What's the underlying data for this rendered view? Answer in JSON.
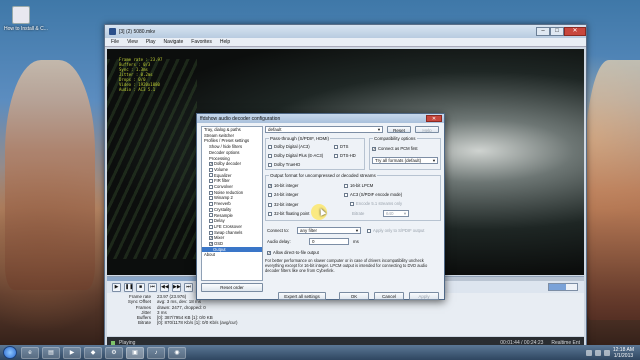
{
  "desktop": {
    "icon_label": "How to Install & C..."
  },
  "player": {
    "title": "[3] (2) 5080.mkv",
    "menu": [
      "File",
      "View",
      "Play",
      "Navigate",
      "Favorites",
      "Help"
    ],
    "osd_lines": [
      "Frame rate : 23.97",
      "Buffers : 0/3",
      "Sync : 1.3ms",
      "Jitter : 0.2ms",
      "Drops : 0/0",
      "Video : 1920x1080",
      "Audio : AC3 5.1"
    ],
    "seek_position_fraction": 0.27,
    "volume_fraction": 0.6,
    "stats": [
      {
        "k": "Frame rate",
        "v": "23.97 (23.976)"
      },
      {
        "k": "Sync Offset",
        "v": "avg: 3 ms, dev: 18 ms"
      },
      {
        "k": "Frames",
        "v": "drawn: 2477, dropped: 0"
      },
      {
        "k": "Jitter",
        "v": "3 ms"
      },
      {
        "k": "Buffers",
        "v": "[0]: 387/7954 KB [1]: 0/0 KB"
      },
      {
        "k": "Bitrate",
        "v": "[0]: 870/1178 Kb/s [1]: 0/0 Kb/s (avg/cur)"
      }
    ],
    "status": "Playing",
    "time": "00:01:44 / 00:24:23",
    "status_right": "Realtime Ent"
  },
  "dialog": {
    "title": "ffdshow audio decoder configuration",
    "preset_value": "default",
    "reset_label": "Reset",
    "help_label": "Help",
    "tree": [
      {
        "label": "Tray, dialog & paths",
        "level": 0,
        "check": null
      },
      {
        "label": "Stream switcher",
        "level": 0,
        "check": null
      },
      {
        "label": "Profiles / Preset settings",
        "level": 0,
        "check": null
      },
      {
        "label": "Show / hide filters",
        "level": 1,
        "check": null
      },
      {
        "label": "Decoder options",
        "level": 1,
        "check": null
      },
      {
        "label": "Processing",
        "level": 1,
        "check": null
      },
      {
        "label": "Dolby decoder",
        "level": 1,
        "check": true
      },
      {
        "label": "Volume",
        "level": 1,
        "check": false
      },
      {
        "label": "Equalizer",
        "level": 1,
        "check": false
      },
      {
        "label": "FIR filter",
        "level": 1,
        "check": false
      },
      {
        "label": "Convolver",
        "level": 1,
        "check": false
      },
      {
        "label": "Noise reduction",
        "level": 1,
        "check": false
      },
      {
        "label": "Winamp 2",
        "level": 1,
        "check": false
      },
      {
        "label": "Freeverb",
        "level": 1,
        "check": false
      },
      {
        "label": "Crystality",
        "level": 1,
        "check": false
      },
      {
        "label": "Resample",
        "level": 1,
        "check": false
      },
      {
        "label": "Delay",
        "level": 1,
        "check": false
      },
      {
        "label": "LFE Crossover",
        "level": 1,
        "check": false
      },
      {
        "label": "Swap channels",
        "level": 1,
        "check": false
      },
      {
        "label": "Mixer",
        "level": 1,
        "check": true
      },
      {
        "label": "OSD",
        "level": 1,
        "check": true
      },
      {
        "label": "Output",
        "level": 2,
        "check": null,
        "selected": true
      },
      {
        "label": "About",
        "level": 0,
        "check": null
      }
    ],
    "reset_order_label": "Reset order",
    "passthrough": {
      "title": "Pass-through (S/PDIF, HDMI)",
      "options": [
        {
          "label": "Dolby Digital (AC3)",
          "checked": false
        },
        {
          "label": "DTS",
          "checked": false
        },
        {
          "label": "Dolby Digital Plus (E-AC3)",
          "checked": false
        },
        {
          "label": "DTS-HD",
          "checked": false
        },
        {
          "label": "Dolby TrueHD",
          "checked": false
        }
      ]
    },
    "compat": {
      "title": "Compatibility options",
      "connect_pcm": "Connect as PCM first",
      "formats": "Try all formats (default)"
    },
    "output_format": {
      "title": "Output format for uncompressed or decoded streams",
      "left": [
        {
          "label": "16-bit integer",
          "checked": true
        },
        {
          "label": "24-bit integer",
          "checked": false
        },
        {
          "label": "32-bit integer",
          "checked": false
        },
        {
          "label": "32-bit floating point",
          "checked": false
        }
      ],
      "right": [
        {
          "label": "16-bit LPCM",
          "checked": false,
          "disabled": false
        },
        {
          "label": "AC3 (S/PDIF encode mode)",
          "checked": false,
          "disabled": false
        },
        {
          "label": "Encode 5.1 streams only",
          "checked": false,
          "disabled": true
        }
      ],
      "bitrate_label": "Bitrate",
      "bitrate_value": "640"
    },
    "connect_to_label": "Connect to:",
    "connect_to_value": "any filter",
    "apply_audio_label": "Apply only to S/PDIF output",
    "audio_delay_label": "Audio delay:",
    "audio_delay_value": "0",
    "audio_delay_unit": "ms",
    "allow_direct_label": "Allow direct-to-file output",
    "info_text": "For better performance on slower computer or in case of drivers incompatibility uncheck everything except for 16-bit integer. LPCM output is intended for connecting to DVD audio decoder filters like one from Cyberlink.",
    "buttons": {
      "expert": "Expert all settings",
      "ok": "OK",
      "cancel": "Cancel",
      "apply": "Apply"
    }
  },
  "taskbar": {
    "time": "12:18 AM",
    "date": "1/1/2013"
  }
}
